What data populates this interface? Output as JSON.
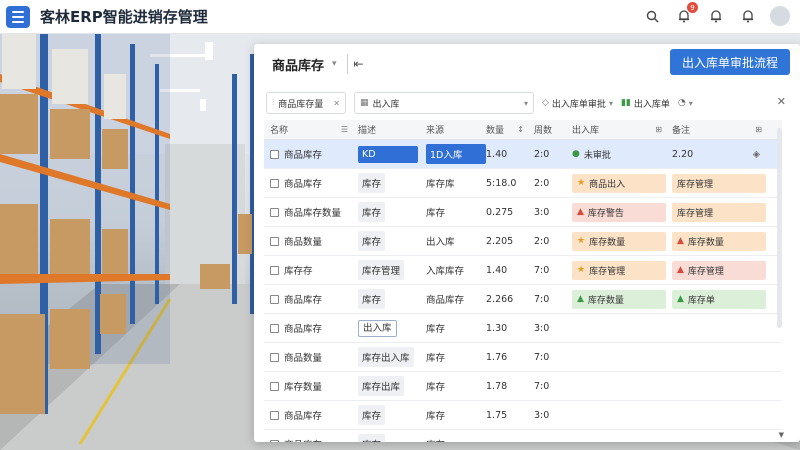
{
  "app": {
    "title": "客林ERP智能进销存管理",
    "notif_count": "9"
  },
  "panel": {
    "title": "商品库存",
    "approve_btn": "出入库单审批流程",
    "filters": [
      {
        "label": "商品库存量"
      },
      {
        "label": "出入库"
      },
      {
        "label": "出入库单审批"
      },
      {
        "label": "出入库单"
      }
    ],
    "columns": [
      "名称",
      "描述",
      "来源",
      "数量",
      "周数",
      "出入库",
      "备注"
    ],
    "rows": [
      {
        "name": "商品库存",
        "desc": "KD",
        "src": "1D入库",
        "qty": "1.40",
        "wk": "2:0",
        "status": "未审批",
        "status_color": "plain-green",
        "note": "2.20",
        "selected": true
      },
      {
        "name": "商品库存",
        "desc": "库存",
        "src": "库存库",
        "qty": "5:18.0",
        "wk": "2:0",
        "status": "商品出入",
        "status_color": "orange",
        "note": "库存管理",
        "selected": false
      },
      {
        "name": "商品库存数量",
        "desc": "库存",
        "src": "库存",
        "qty": "0.275",
        "wk": "3:0",
        "status": "库存警告",
        "status_color": "red",
        "note": "库存管理",
        "selected": false
      },
      {
        "name": "商品数量",
        "desc": "库存",
        "src": "出入库",
        "qty": "2.205",
        "wk": "2:0",
        "status": "库存数量",
        "status_color": "orange",
        "note": "库存数量",
        "selected": false
      },
      {
        "name": "库存存",
        "desc": "库存管理",
        "src": "入库库存",
        "qty": "1.40",
        "wk": "7:0",
        "status": "库存管理",
        "status_color": "orange",
        "note": "库存管理",
        "selected": false
      },
      {
        "name": "商品库存",
        "desc": "库存",
        "src": "商品库存",
        "qty": "2.266",
        "wk": "7:0",
        "status": "库存数量",
        "status_color": "green",
        "note": "库存单",
        "selected": false
      },
      {
        "name": "商品库存",
        "desc": "出入库",
        "src": "库存",
        "qty": "1.30",
        "wk": "3:0",
        "status": "",
        "status_color": "none",
        "note": "",
        "selected": false
      },
      {
        "name": "商品数量",
        "desc": "库存出入库",
        "src": "库存",
        "qty": "1.76",
        "wk": "7:0",
        "status": "",
        "status_color": "none",
        "note": "",
        "selected": false
      },
      {
        "name": "库存数量",
        "desc": "库存出库",
        "src": "库存",
        "qty": "1.78",
        "wk": "7:0",
        "status": "",
        "status_color": "none",
        "note": "",
        "selected": false
      },
      {
        "name": "商品库存",
        "desc": "库存",
        "src": "库存",
        "qty": "1.75",
        "wk": "3:0",
        "status": "",
        "status_color": "none",
        "note": "",
        "selected": false
      },
      {
        "name": "商品库存",
        "desc": "库存",
        "src": "库存",
        "qty": "",
        "wk": "",
        "status": "",
        "status_color": "none",
        "note": "",
        "selected": false
      }
    ]
  },
  "colors": {
    "primary": "#2f74d6",
    "selected_row": "#dfeafc",
    "accent_orange": "#e07b28",
    "accent_red": "#d84a3a",
    "accent_green": "#3b9a45"
  },
  "icons": [
    "menu-icon",
    "search-icon",
    "bell-icon",
    "notification-icon",
    "avatar",
    "back-icon",
    "close-icon",
    "filter-icon",
    "calendar-icon",
    "location-pin-icon",
    "star-icon",
    "warning-icon",
    "check-circle-icon"
  ]
}
